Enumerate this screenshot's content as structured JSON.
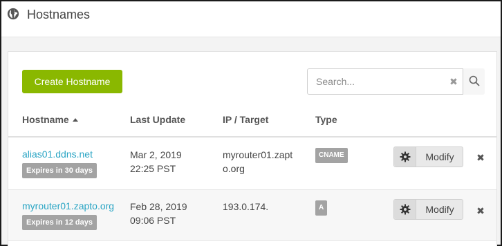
{
  "header": {
    "title": "Hostnames",
    "icon": "globe-icon"
  },
  "toolbar": {
    "create_label": "Create Hostname",
    "search_placeholder": "Search...",
    "clear_glyph": "✖",
    "accent_color": "#8ab800"
  },
  "table": {
    "columns": [
      "Hostname",
      "Last Update",
      "IP / Target",
      "Type"
    ],
    "sort_column": "Hostname",
    "rows": [
      {
        "hostname": "alias01.ddns.net",
        "expires": "Expires in 30 days",
        "updated_date": "Mar 2, 2019",
        "updated_time": "22:25 PST",
        "target_line1": "myrouter01.zapt",
        "target_line2": "o.org",
        "type": "CNAME",
        "modify_label": "Modify",
        "delete_glyph": "✖"
      },
      {
        "hostname": "myrouter01.zapto.org",
        "expires": "Expires in 12 days",
        "updated_date": "Feb 28, 2019",
        "updated_time": "09:06 PST",
        "target_line1": "193.0.174.",
        "target_line2": "",
        "type": "A",
        "modify_label": "Modify",
        "delete_glyph": "✖"
      }
    ]
  },
  "colors": {
    "link": "#2aa5c4",
    "badge": "#a3a3a3"
  }
}
